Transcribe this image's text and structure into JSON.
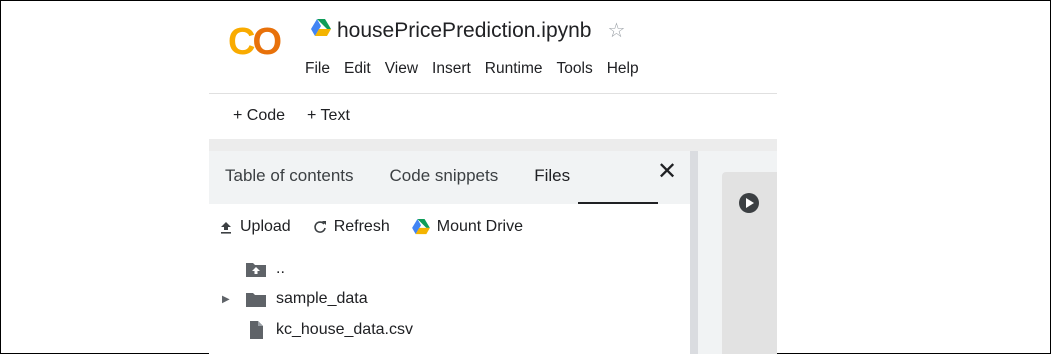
{
  "header": {
    "logo_text_a": "C",
    "logo_text_b": "O",
    "file_title": "housePricePrediction.ipynb",
    "star_glyph": "☆",
    "menu": [
      "File",
      "Edit",
      "View",
      "Insert",
      "Runtime",
      "Tools",
      "Help"
    ]
  },
  "toolbar": {
    "code_label": "+ Code",
    "text_label": "+ Text"
  },
  "sidepanel": {
    "tabs": [
      "Table of contents",
      "Code snippets",
      "Files"
    ],
    "active_tab": "Files",
    "close_glyph": "✕",
    "actions": {
      "upload": "Upload",
      "refresh": "Refresh",
      "mount_drive": "Mount Drive"
    },
    "tree": [
      {
        "name": "..",
        "icon": "folder-up-icon"
      },
      {
        "name": "sample_data",
        "icon": "folder-icon"
      },
      {
        "name": "kc_house_data.csv",
        "icon": "file-icon"
      }
    ]
  },
  "colors": {
    "brand_yellow": "#f9ab00",
    "brand_orange": "#e8710a",
    "panel_bg": "#f1f3f4"
  }
}
